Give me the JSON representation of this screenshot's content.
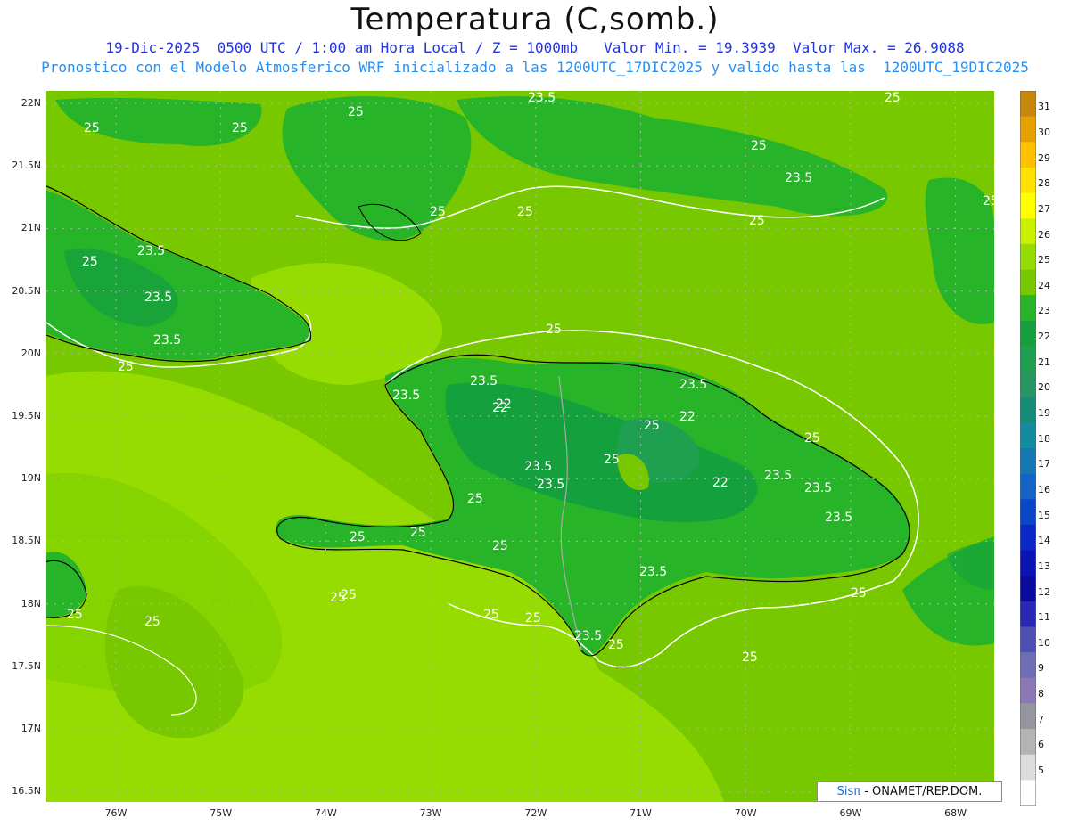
{
  "header": {
    "title": "Temperatura (C,somb.)",
    "line1": "19-Dic-2025  0500 UTC / 1:00 am Hora Local / Z = 1000mb   Valor Min. = 19.3939  Valor Max. = 26.9088",
    "line2": "Pronostico con el Modelo Atmosferico WRF inicializado a las 1200UTC_17DIC2025 y valido hasta las  1200UTC_19DIC2025"
  },
  "axes": {
    "lat_labels": [
      "22N",
      "21.5N",
      "21N",
      "20.5N",
      "20N",
      "19.5N",
      "19N",
      "18.5N",
      "18N",
      "17.5N",
      "17N",
      "16.5N"
    ],
    "lon_labels": [
      "76W",
      "75W",
      "74W",
      "73W",
      "72W",
      "71W",
      "70W",
      "69W",
      "68W"
    ]
  },
  "colorbar": {
    "labels": [
      "31",
      "30",
      "29",
      "28",
      "27",
      "26",
      "25",
      "24",
      "23",
      "22",
      "21",
      "20",
      "19",
      "18",
      "17",
      "16",
      "15",
      "14",
      "13",
      "12",
      "11",
      "10",
      "9",
      "8",
      "7",
      "6",
      "5"
    ],
    "colors": [
      "#c8860a",
      "#e8a000",
      "#ffc000",
      "#ffe000",
      "#ffff00",
      "#c8f000",
      "#96dc00",
      "#78c800",
      "#28b428",
      "#14a03c",
      "#1ea050",
      "#289664",
      "#148c78",
      "#148ca0",
      "#1478b4",
      "#1464c8",
      "#0a46c8",
      "#0a28c8",
      "#0a14b4",
      "#0a0aa0",
      "#2828b4",
      "#5050b4",
      "#6e6eb4",
      "#8c78b4",
      "#9696a0",
      "#b4b4b4",
      "#dcdcdc",
      "#ffffff"
    ]
  },
  "contours": {
    "labels": [
      "25",
      "25",
      "25",
      "23.5",
      "25",
      "25",
      "25",
      "25",
      "23.5",
      "25",
      "25",
      "23.5",
      "25",
      "23.5",
      "23.5",
      "25",
      "25",
      "23.5",
      "22",
      "23.5",
      "23.5",
      "22",
      "22",
      "25",
      "25",
      "23.5",
      "23.5",
      "22",
      "23.5",
      "23.5",
      "25",
      "25",
      "23.5",
      "25",
      "25",
      "25",
      "25",
      "23.5",
      "25",
      "25",
      "25",
      "25",
      "25",
      "25",
      "23.5",
      "25",
      "25"
    ]
  },
  "credit": {
    "sis": "Sisπ",
    "text": "- ONAMET/REP.DOM."
  }
}
